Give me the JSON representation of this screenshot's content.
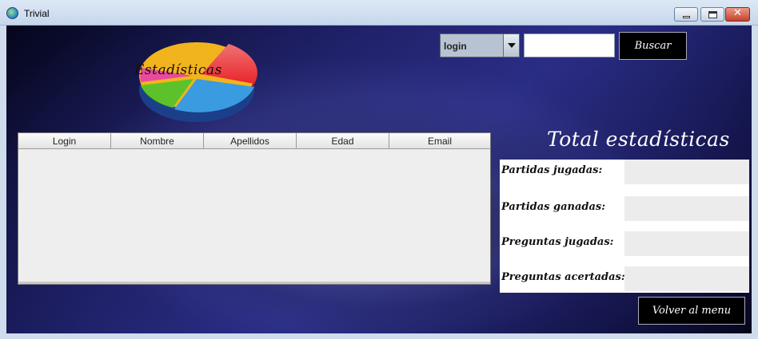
{
  "window": {
    "title": "Trivial"
  },
  "logo": {
    "label": "Estadísticas",
    "slice_colors": [
      "#e8262a",
      "#3a9be0",
      "#5dc12c",
      "#e94a9c",
      "#f2b41d"
    ]
  },
  "search": {
    "combo_value": "login",
    "input_value": "",
    "button_label": "Buscar"
  },
  "table": {
    "columns": [
      "Login",
      "Nombre",
      "Apellidos",
      "Edad",
      "Email"
    ],
    "rows": []
  },
  "stats": {
    "title": "Total estadísticas",
    "rows": [
      {
        "label": "Partidas jugadas:",
        "value": ""
      },
      {
        "label": "Partidas ganadas:",
        "value": ""
      },
      {
        "label": "Preguntas jugadas:",
        "value": ""
      },
      {
        "label": "Preguntas acertadas:",
        "value": ""
      }
    ]
  },
  "back_button": {
    "label": "Volver al menu"
  },
  "colors": {
    "background_dark": "#1e2067",
    "button_black": "#000000",
    "panel_white": "#ffffff"
  }
}
